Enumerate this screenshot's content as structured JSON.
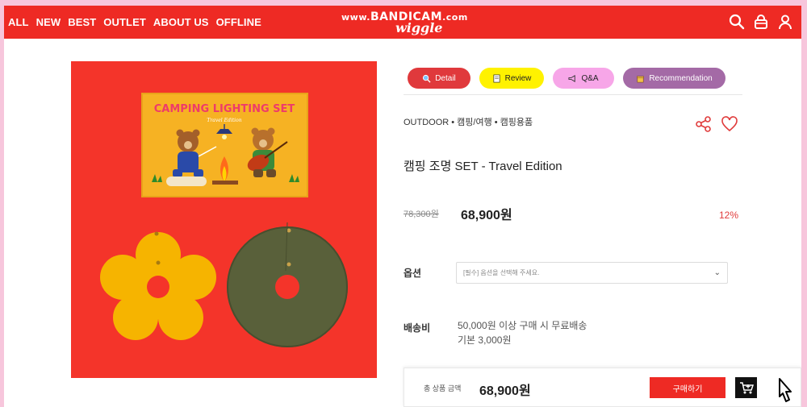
{
  "nav": [
    "ALL",
    "NEW",
    "BEST",
    "OUTLET",
    "ABOUT US",
    "OFFLINE"
  ],
  "brand": {
    "watermark_pre": "www.",
    "watermark_main": "BANDICAM",
    "watermark_post": ".com",
    "logo": "wiggle"
  },
  "tabs": {
    "detail": "Detail",
    "review": "Review",
    "qa": "Q&A",
    "recommendation": "Recommendation"
  },
  "product_image": {
    "box_title": "CAMPING LIGHTING SET",
    "box_subtitle": "Travel Edition"
  },
  "product": {
    "category": "OUTDOOR • 캠핑/여행 • 캠핑용품",
    "title": "캠핑 조명 SET - Travel Edition",
    "price_old": "78,300원",
    "price_new": "68,900원",
    "discount": "12%"
  },
  "option": {
    "label": "옵션",
    "placeholder": "[필수] 옵션을 선택해 주세요."
  },
  "shipping": {
    "label": "배송비",
    "line1": "50,000원 이상 구매 시 무료배송",
    "line2": "기본 3,000원"
  },
  "bottom_bar": {
    "total_label": "총 상품 금액",
    "total_value": "68,900원",
    "buy_label": "구매하기"
  },
  "colors": {
    "brand_red": "#ee2a24",
    "page_bg": "#f7c6dc"
  }
}
